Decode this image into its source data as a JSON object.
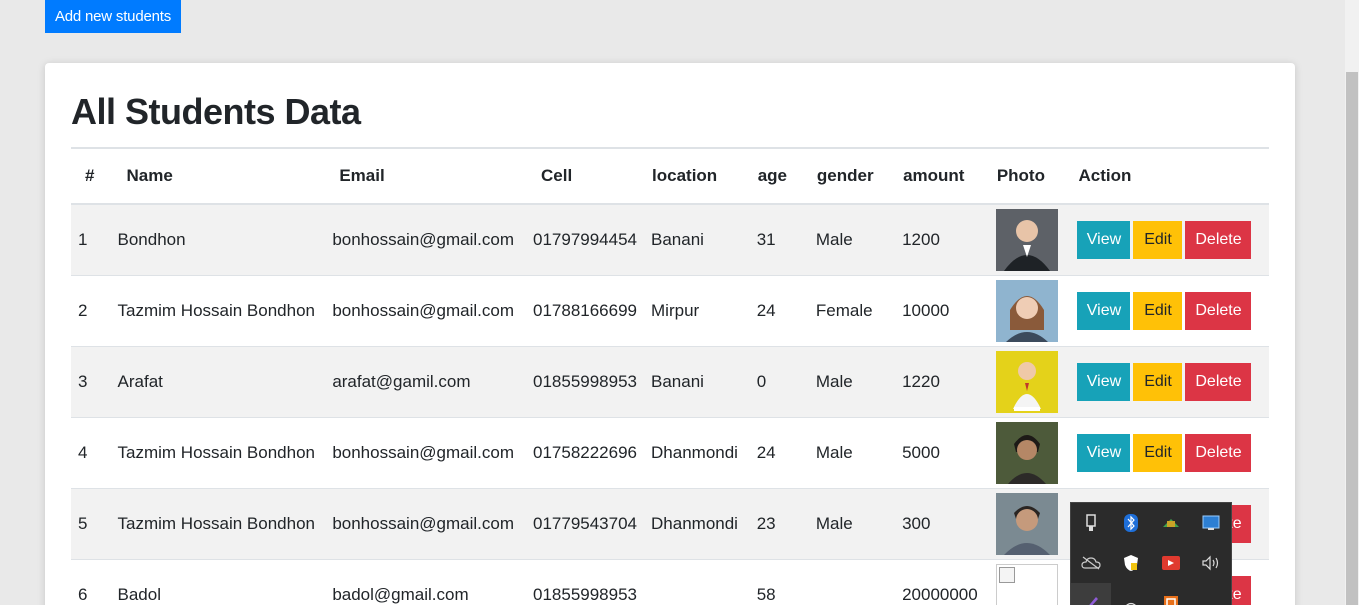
{
  "toolbar": {
    "add_label": "Add new students"
  },
  "card": {
    "title": "All Students Data"
  },
  "table": {
    "headers": [
      "#",
      "Name",
      "Email",
      "Cell",
      "location",
      "age",
      "gender",
      "amount",
      "Photo",
      "Action"
    ],
    "actions": {
      "view": "View",
      "edit": "Edit",
      "delete": "Delete"
    },
    "rows": [
      {
        "id": "1",
        "name": "Bondhon",
        "email": "bonhossain@gmail.com",
        "cell": "01797994454",
        "location": "Banani",
        "age": "31",
        "gender": "Male",
        "amount": "1200"
      },
      {
        "id": "2",
        "name": "Tazmim Hossain Bondhon",
        "email": "bonhossain@gmail.com",
        "cell": "01788166699",
        "location": "Mirpur",
        "age": "24",
        "gender": "Female",
        "amount": "10000"
      },
      {
        "id": "3",
        "name": "Arafat",
        "email": "arafat@gamil.com",
        "cell": "01855998953",
        "location": "Banani",
        "age": "0",
        "gender": "Male",
        "amount": "1220"
      },
      {
        "id": "4",
        "name": "Tazmim Hossain Bondhon",
        "email": "bonhossain@gmail.com",
        "cell": "01758222696",
        "location": "Dhanmondi",
        "age": "24",
        "gender": "Male",
        "amount": "5000"
      },
      {
        "id": "5",
        "name": "Tazmim Hossain Bondhon",
        "email": "bonhossain@gmail.com",
        "cell": "01779543704",
        "location": "Dhanmondi",
        "age": "23",
        "gender": "Male",
        "amount": "300"
      },
      {
        "id": "6",
        "name": "Badol",
        "email": "badol@gmail.com",
        "cell": "01855998953",
        "location": "",
        "age": "58",
        "gender": "",
        "amount": "20000000"
      }
    ]
  },
  "colors": {
    "primary": "#007bff",
    "info": "#17a2b8",
    "warning": "#ffc107",
    "danger": "#dc3545"
  },
  "tray": {
    "icons": [
      "usb-icon",
      "bluetooth-icon",
      "network-icon",
      "display-icon",
      "cloud-off-icon",
      "security-icon",
      "record-icon",
      "volume-icon",
      "pen-icon",
      "wifi-icon",
      "app-icon"
    ]
  }
}
